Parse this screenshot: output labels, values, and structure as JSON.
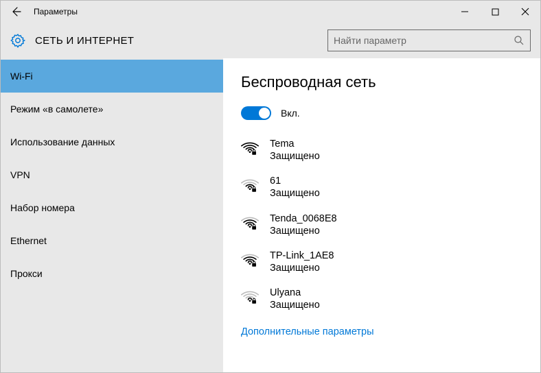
{
  "window": {
    "title": "Параметры"
  },
  "header": {
    "section": "СЕТЬ И ИНТЕРНЕТ",
    "search_placeholder": "Найти параметр"
  },
  "sidebar": {
    "items": [
      {
        "label": "Wi-Fi",
        "active": true
      },
      {
        "label": "Режим «в самолете»",
        "active": false
      },
      {
        "label": "Использование данных",
        "active": false
      },
      {
        "label": "VPN",
        "active": false
      },
      {
        "label": "Набор номера",
        "active": false
      },
      {
        "label": "Ethernet",
        "active": false
      },
      {
        "label": "Прокси",
        "active": false
      }
    ]
  },
  "main": {
    "heading": "Беспроводная сеть",
    "toggle": {
      "on": true,
      "label": "Вкл."
    },
    "networks": [
      {
        "name": "Tema",
        "status": "Защищено",
        "strength": 4
      },
      {
        "name": "61",
        "status": "Защищено",
        "strength": 2
      },
      {
        "name": "Tenda_0068E8",
        "status": "Защищено",
        "strength": 3
      },
      {
        "name": "TP-Link_1AE8",
        "status": "Защищено",
        "strength": 3
      },
      {
        "name": "Ulyana",
        "status": "Защищено",
        "strength": 1
      }
    ],
    "advanced_link": "Дополнительные параметры"
  },
  "colors": {
    "accent": "#0078d7",
    "sidebar_bg": "#e8e8e8",
    "selected": "#5aa8de"
  }
}
